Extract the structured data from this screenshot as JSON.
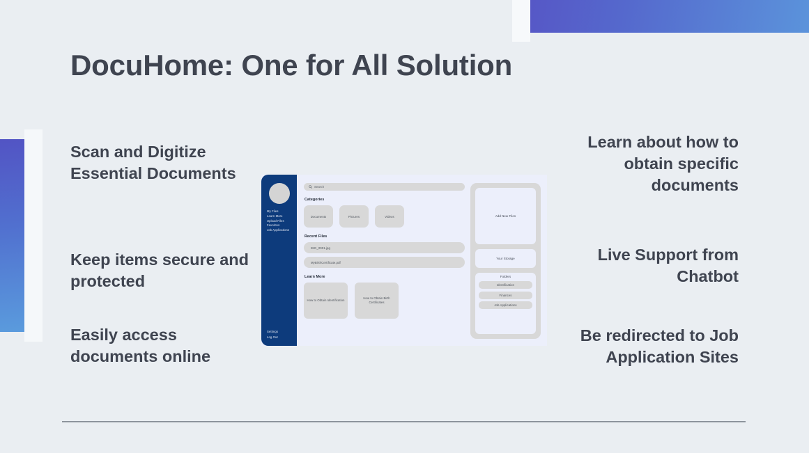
{
  "slide": {
    "title": "DocuHome: One for All Solution",
    "background_color": "#eaeef2",
    "text_color": "#3f4450",
    "accent_gradient_start": "#5657c6",
    "accent_gradient_end": "#5b93db"
  },
  "features_left": [
    "Scan and Digitize Essential Documents",
    "Keep items secure and protected",
    "Easily access documents online"
  ],
  "features_right": [
    "Learn about how to obtain specific documents",
    "Live Support from Chatbot",
    "Be redirected to Job Application Sites"
  ],
  "mockup": {
    "sidebar": {
      "brand_color": "#0d3b7c",
      "avatar": "user-avatar",
      "nav": [
        "My Files",
        "Learn More",
        "Upload Files",
        "Favorites",
        "Job Applications"
      ],
      "bottom_nav": [
        "Settings",
        "Log Out"
      ]
    },
    "search": {
      "placeholder": "Search",
      "icon": "search-icon"
    },
    "categories": {
      "heading": "Categories",
      "items": [
        "Documents",
        "Pictures",
        "Videos"
      ]
    },
    "recent_files": {
      "heading": "Recent Files",
      "items": [
        "IMG_0001.jpg",
        "MyBirthCertificate.pdf"
      ]
    },
    "learn_more": {
      "heading": "Learn More",
      "cards": [
        "How to Obtain Identification",
        "How to Obtain Birth Certificates"
      ]
    },
    "right_panel": {
      "add_new_files": "Add New Files",
      "your_storage": "Your Storage",
      "folders_title": "Folders",
      "folders": [
        "Identification",
        "Finances",
        "Job Applications"
      ]
    }
  }
}
